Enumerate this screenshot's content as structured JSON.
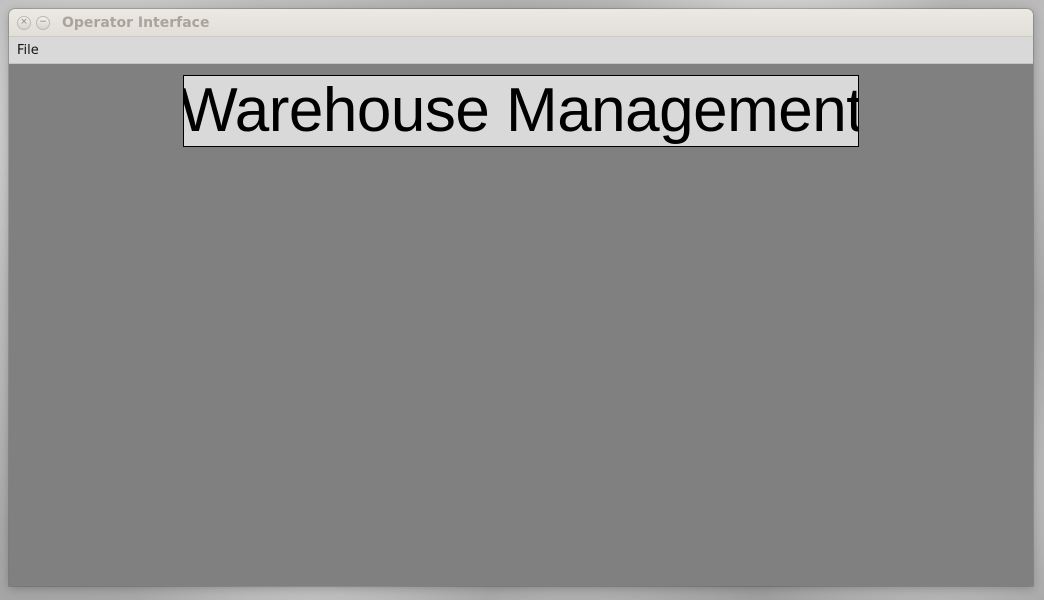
{
  "window": {
    "title": "Operator Interface",
    "close_glyph": "×",
    "minimize_glyph": "−"
  },
  "menubar": {
    "items": [
      {
        "label": "File"
      }
    ]
  },
  "main": {
    "heading": "Warehouse Management"
  },
  "colors": {
    "content_background": "#808080",
    "heading_background": "#d9d9d9",
    "menubar_background": "#d9d9d9",
    "titlebar_background": "#e6e2dc"
  },
  "icons": {
    "close": "close-icon",
    "minimize": "minimize-icon"
  }
}
